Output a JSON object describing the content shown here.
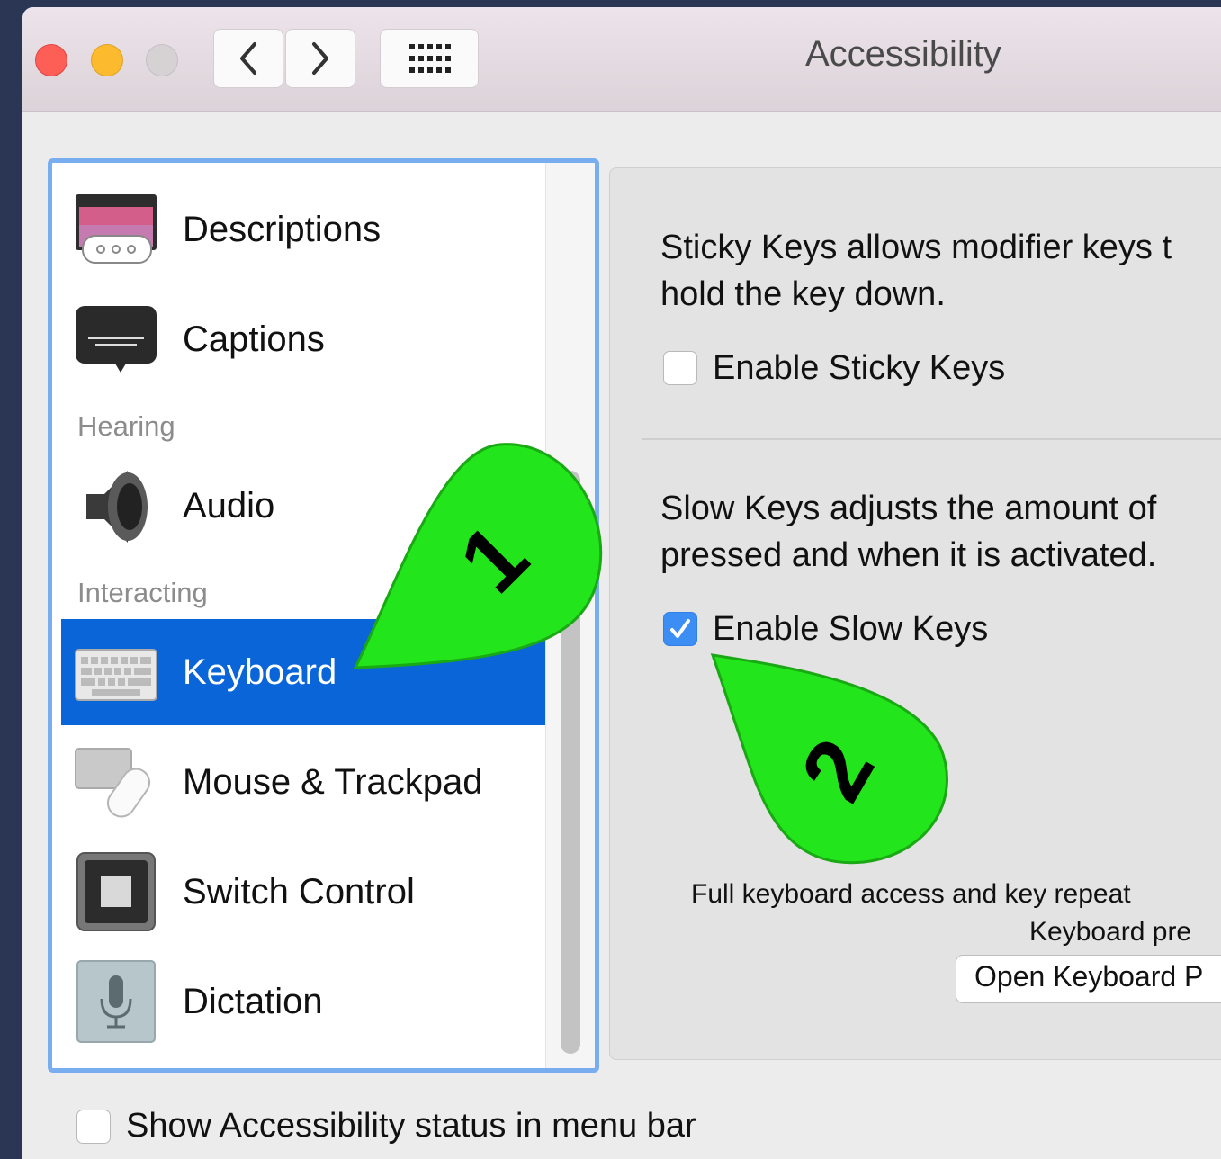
{
  "window": {
    "title": "Accessibility"
  },
  "sidebar": {
    "items": [
      {
        "label": "Descriptions",
        "icon": "descriptions-icon"
      },
      {
        "label": "Captions",
        "icon": "captions-icon"
      },
      {
        "label": "Audio",
        "icon": "audio-speaker-icon"
      },
      {
        "label": "Keyboard",
        "icon": "keyboard-icon",
        "selected": true
      },
      {
        "label": "Mouse & Trackpad",
        "icon": "mouse-trackpad-icon"
      },
      {
        "label": "Switch Control",
        "icon": "switch-control-icon"
      },
      {
        "label": "Dictation",
        "icon": "microphone-icon"
      }
    ],
    "sections": {
      "hearing": "Hearing",
      "interacting": "Interacting"
    }
  },
  "panel": {
    "sticky_desc_line1": "Sticky Keys allows modifier keys t",
    "sticky_desc_line2": "hold the key down.",
    "sticky_checkbox": {
      "label": "Enable Sticky Keys",
      "checked": false
    },
    "slow_desc_line1": "Slow Keys adjusts the amount of",
    "slow_desc_line2": "pressed and when it is activated.",
    "slow_checkbox": {
      "label": "Enable Slow Keys",
      "checked": true
    },
    "note_line1": "Full keyboard access and key repeat",
    "note_line2": "Keyboard pre",
    "open_button": "Open Keyboard P"
  },
  "footer": {
    "status_checkbox": {
      "label": "Show Accessibility status in menu bar",
      "checked": false
    }
  },
  "callouts": [
    "1",
    "2"
  ],
  "colors": {
    "selection": "#0a65d8",
    "callout": "#22e61b",
    "checkbox_checked": "#3d8ef4"
  }
}
